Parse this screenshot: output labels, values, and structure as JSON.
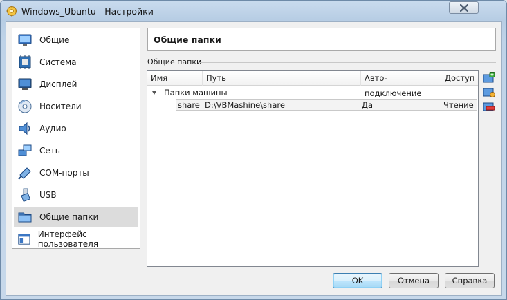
{
  "window": {
    "title": "Windows_Ubuntu - Настройки",
    "close_icon": "close-icon"
  },
  "sidebar": {
    "items": [
      {
        "label": "Общие",
        "icon": "general-icon"
      },
      {
        "label": "Система",
        "icon": "system-chip-icon"
      },
      {
        "label": "Дисплей",
        "icon": "monitor-icon"
      },
      {
        "label": "Носители",
        "icon": "storage-disc-icon"
      },
      {
        "label": "Аудио",
        "icon": "speaker-icon"
      },
      {
        "label": "Сеть",
        "icon": "network-icon"
      },
      {
        "label": "COM-порты",
        "icon": "serial-port-icon"
      },
      {
        "label": "USB",
        "icon": "usb-icon"
      },
      {
        "label": "Общие папки",
        "icon": "shared-folder-icon",
        "selected": true
      },
      {
        "label": "Интерфейс пользователя",
        "icon": "user-interface-icon"
      }
    ]
  },
  "main": {
    "header": "Общие папки",
    "group_label": "Общие папки",
    "columns": [
      "Имя",
      "Путь",
      "Авто-подключение",
      "Доступ"
    ],
    "machine_group": "Папки машины",
    "rows": [
      {
        "name": "share",
        "path": "D:\\VBMashine\\share",
        "auto": "Да",
        "access": "Чтение"
      }
    ],
    "tools": [
      "add-folder-icon",
      "edit-folder-icon",
      "remove-folder-icon"
    ]
  },
  "buttons": {
    "ok": "OK",
    "cancel": "Отмена",
    "help": "Справка"
  }
}
